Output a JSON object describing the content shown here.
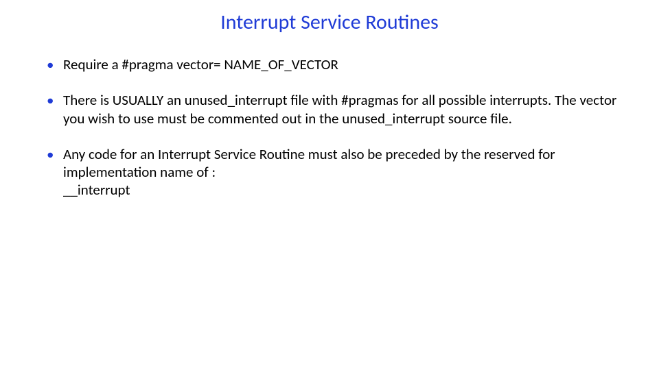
{
  "title": "Interrupt Service Routines",
  "bullets": {
    "b1": "Require a #pragma vector= NAME_OF_VECTOR",
    "b2": "There is USUALLY an unused_interrupt file with #pragmas for all possible interrupts. The vector you wish to use must be commented out in the unused_interrupt source file.",
    "b3_line1": "Any code for an Interrupt Service Routine must also be preceded by the reserved for implementation name of :",
    "b3_line2": "__interrupt"
  }
}
